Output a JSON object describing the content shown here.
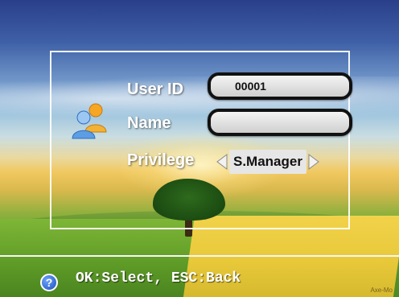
{
  "form": {
    "user_id_label": "User ID",
    "user_id_value": "00001",
    "name_label": "Name",
    "name_value": "",
    "privilege_label": "Privilege",
    "privilege_value": "S.Manager"
  },
  "footer": {
    "help_glyph": "?",
    "hint": "OK:Select, ESC:Back"
  },
  "watermark": "Axe-Mo",
  "icons": {
    "users": "users-icon",
    "left": "arrow-left-icon",
    "right": "arrow-right-icon",
    "help": "help-icon"
  },
  "colors": {
    "frame": "#ffffff",
    "field_border": "#111111",
    "help_blue": "#1b4fb8"
  }
}
